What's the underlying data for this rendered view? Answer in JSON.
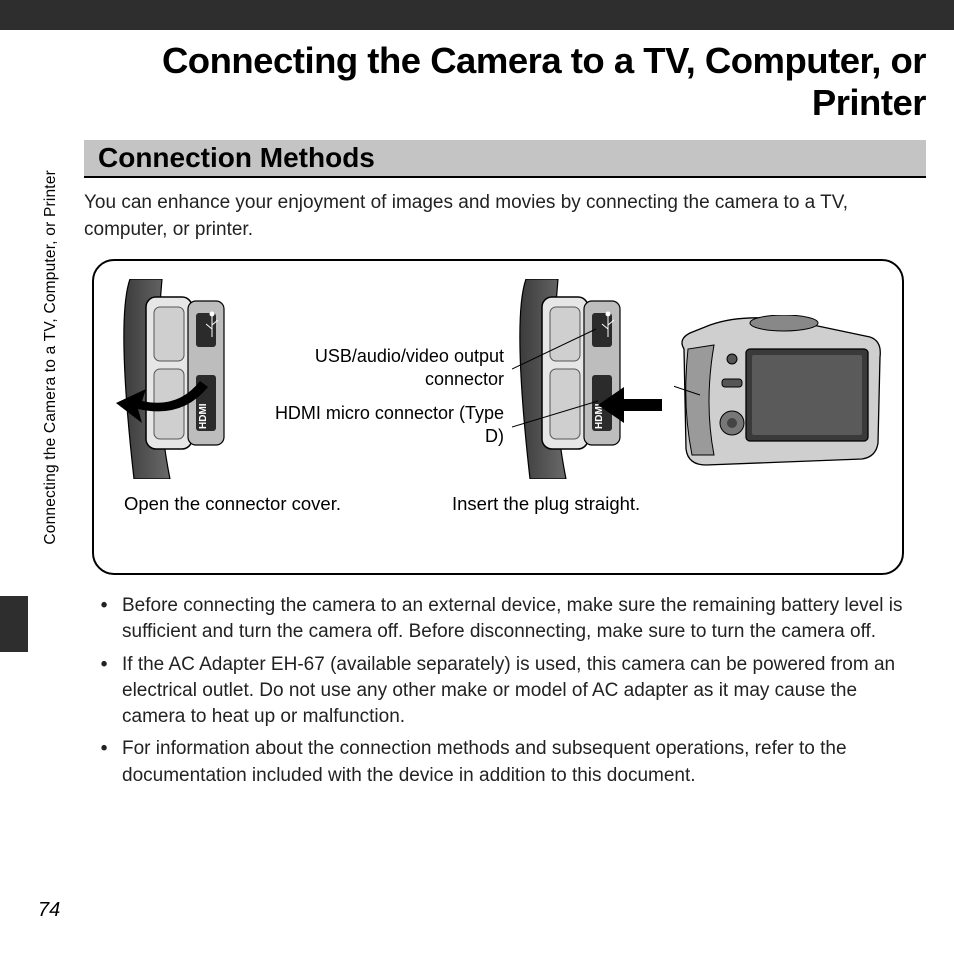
{
  "chapter_title": "Connecting the Camera to a TV, Computer, or Printer",
  "section_title": "Connection Methods",
  "side_chapter": "Connecting the Camera to a TV, Computer, or Printer",
  "intro": "You can enhance your enjoyment of images and movies by connecting the camera to a TV, computer, or printer.",
  "figure": {
    "label_usb": "USB/audio/video output connector",
    "label_hdmi": "HDMI micro connector (Type D)",
    "caption_left": "Open the connector cover.",
    "caption_right": "Insert the plug straight."
  },
  "bullets": [
    "Before connecting the camera to an external device, make sure the remaining battery level is sufficient and turn the camera off. Before disconnecting, make sure to turn the camera off.",
    "If the AC Adapter EH-67 (available separately) is used, this camera can be powered from an electrical outlet. Do not use any other make or model of AC adapter as it may cause the camera to heat up or malfunction.",
    "For information about the connection methods and subsequent operations, refer to the documentation included with the device in addition to this document."
  ],
  "page_number": "74"
}
